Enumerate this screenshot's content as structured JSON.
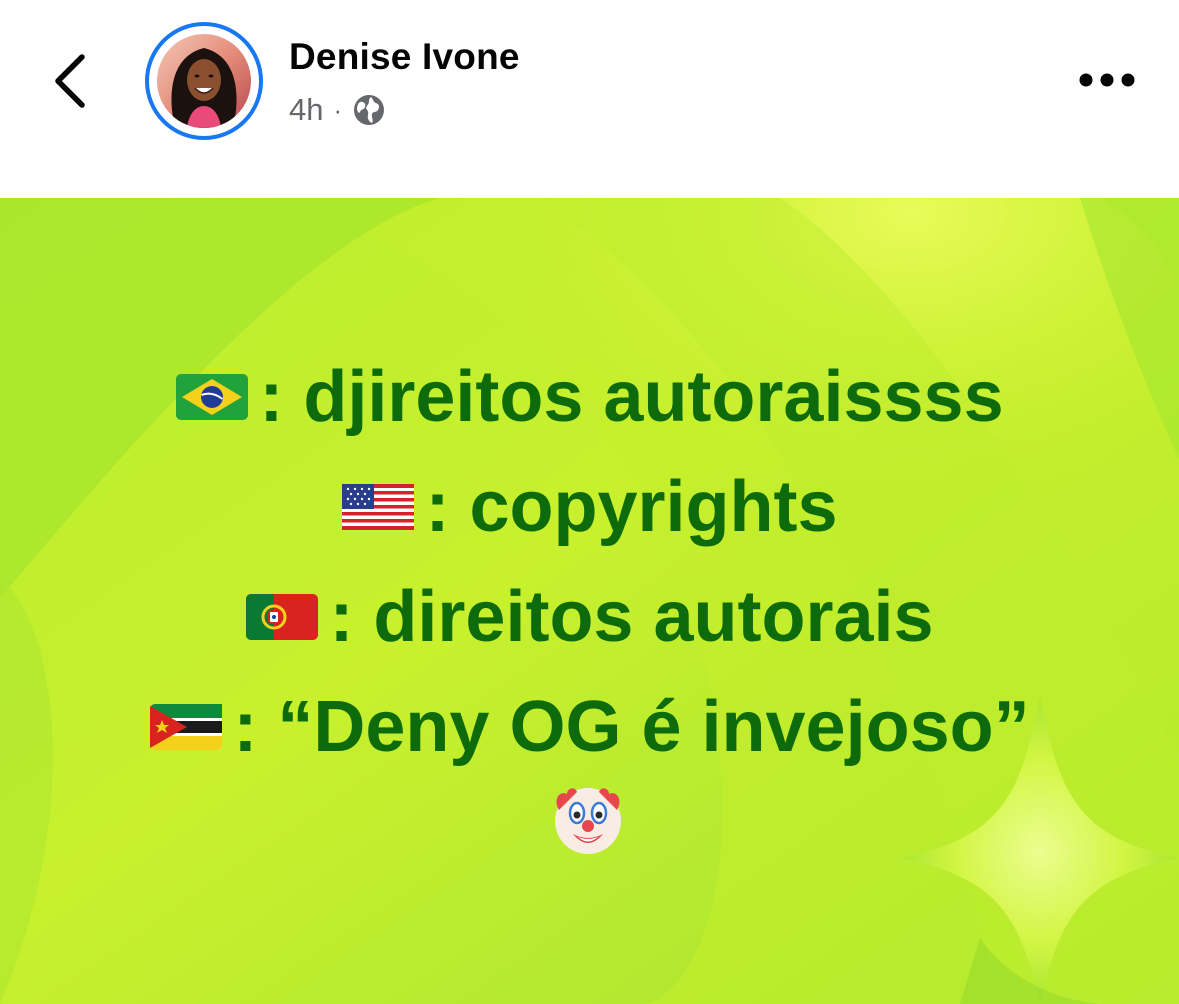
{
  "header": {
    "author_name": "Denise Ivone",
    "time_ago": "4h",
    "separator": "·",
    "audience_icon": "globe-icon",
    "back_icon": "chevron-left-icon",
    "more_icon": "more-dots-icon"
  },
  "post": {
    "lines": [
      {
        "flag_icon": "brazil-flag-icon",
        "text": ": djireitos autoraissss"
      },
      {
        "flag_icon": "usa-flag-icon",
        "text": ": copyrights"
      },
      {
        "flag_icon": "portugal-flag-icon",
        "text": ": direitos autorais"
      },
      {
        "flag_icon": "mozambique-flag-icon",
        "text": " : “Deny OG é invejoso”"
      }
    ],
    "emoji_icon": "clown-face-icon",
    "text_color": "#0e6b0b",
    "background_colors": [
      "#c6f02a",
      "#93e230",
      "#e6fa5c"
    ]
  },
  "colors": {
    "accent": "#1877f2",
    "name": "#050505",
    "meta": "#65676b"
  }
}
